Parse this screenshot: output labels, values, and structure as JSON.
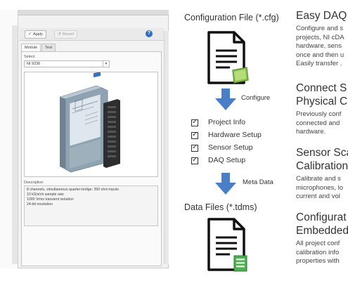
{
  "window": {
    "toolbar": {
      "apply_label": "Apply",
      "revert_label": "Revert",
      "help_glyph": "?"
    },
    "tabs": [
      {
        "label": "Module"
      },
      {
        "label": "Test"
      }
    ],
    "select_label": "Select",
    "select_value": "NI 9236",
    "description_label": "Description",
    "description_lines": [
      "8 channels, simultaneous quarter-bridge: 350 ohm inputs",
      "10 kS/s/ch sample rate",
      "1000 Vrms transient isolation",
      "24-bit resolution"
    ]
  },
  "diagram": {
    "config_file_title": "Configuration File (*.cfg)",
    "configure_label": "Configure",
    "checklist": [
      {
        "label": "Project Info",
        "checked": true
      },
      {
        "label": "Hardware Setup",
        "checked": true
      },
      {
        "label": "Sensor Setup",
        "checked": true
      },
      {
        "label": "DAQ Setup",
        "checked": true
      }
    ],
    "meta_data_label": "Meta Data",
    "data_files_title": "Data Files (*.tdms)",
    "arrow_color": "#4a7fc8",
    "config_badge_color": "#8cc152",
    "data_badge_color": "#4caf50"
  },
  "features": [
    {
      "heading": [
        "Easy DAQ"
      ],
      "body": [
        "Configure and s",
        "projects, NI cDA",
        "hardware, sens",
        "once and then u",
        "Easily transfer ."
      ]
    },
    {
      "heading": [
        "Connect S",
        "Physical Cl"
      ],
      "body": [
        "Previously conf",
        "connected and",
        "hardware."
      ]
    },
    {
      "heading": [
        "Sensor Sca",
        "Calibration"
      ],
      "body": [
        "Calibrate and s",
        "microphones, lo",
        "current and vol"
      ]
    },
    {
      "heading": [
        "Configurat",
        "Embedded"
      ],
      "body": [
        "All project conf",
        "calibration info",
        "properties with"
      ]
    }
  ]
}
